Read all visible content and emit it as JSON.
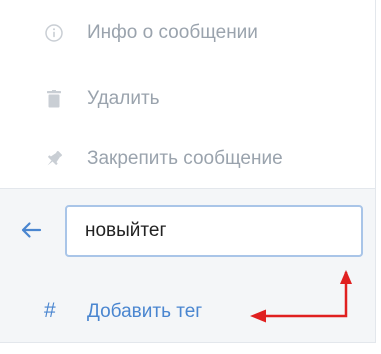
{
  "menu": {
    "items": [
      {
        "label": "Инфо о сообщении",
        "icon": "info-icon"
      },
      {
        "label": "Удалить",
        "icon": "trash-icon"
      },
      {
        "label": "Закрепить сообщение",
        "icon": "pin-icon"
      }
    ]
  },
  "tag_editor": {
    "input_value": "новыйтег",
    "add_label": "Добавить тег",
    "add_icon": "#"
  },
  "colors": {
    "accent": "#4a86d0",
    "muted_text": "#9aa3ad",
    "muted_icon": "#c9ced4",
    "section_bg": "#f4f6f8",
    "annotation_arrow": "#e02020"
  }
}
